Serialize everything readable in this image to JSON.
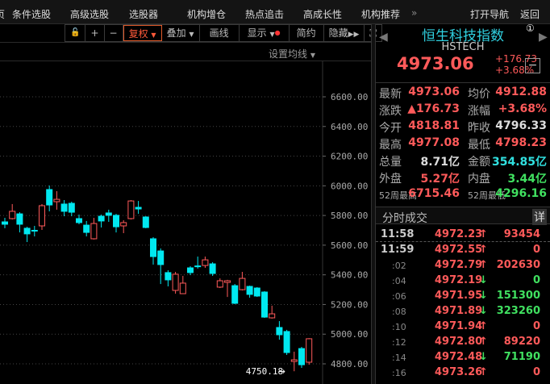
{
  "menu": {
    "items": [
      "页",
      "条件选股",
      "高级选股",
      "选股器",
      "机构增仓",
      "热点追击",
      "高成长性",
      "机构推荐"
    ],
    "more": "»",
    "nav": "打开导航",
    "back": "返回"
  },
  "toolbar": {
    "lock": "🔓",
    "plus": "+",
    "minus": "−",
    "fuquan": "复权",
    "overlay": "叠加",
    "draw": "画线",
    "display": "显示",
    "simple": "简约",
    "hide": "隐藏",
    "expand": "⛶"
  },
  "ma_setting": "设置均线",
  "quote": {
    "name": "恒生科技指数",
    "code": "HSTECH",
    "price": "4973.06",
    "change": "+176.73",
    "pct": "+3.68%",
    "page_badge": "①",
    "collapse": "−"
  },
  "stats": [
    {
      "l1": "最新",
      "v1": "4973.06",
      "c1": "red",
      "l2": "均价",
      "v2": "4912.88",
      "c2": "red"
    },
    {
      "l1": "涨跌",
      "v1": "▲176.73",
      "c1": "red",
      "l2": "涨幅",
      "v2": "+3.68%",
      "c2": "red"
    },
    {
      "l1": "今开",
      "v1": "4818.81",
      "c1": "red",
      "l2": "昨收",
      "v2": "4796.33",
      "c2": "white"
    },
    {
      "l1": "最高",
      "v1": "4977.08",
      "c1": "red",
      "l2": "最低",
      "v2": "4798.23",
      "c2": "red"
    },
    {
      "l1": "总量",
      "v1": "8.71亿",
      "c1": "white",
      "l2": "金额",
      "v2": "354.85亿",
      "c2": "cyan"
    },
    {
      "l1": "外盘",
      "v1": "5.27亿",
      "c1": "red",
      "l2": "内盘",
      "v2": "3.44亿",
      "c2": "green"
    },
    {
      "l1": "52周最高",
      "v1": "6715.46",
      "c1": "red",
      "l2": "52周最低",
      "v2": "4296.16",
      "c2": "green"
    }
  ],
  "ticks_header": {
    "title": "分时成交",
    "detail": "详"
  },
  "ticks": [
    {
      "t": "11:58",
      "p": "4972.23",
      "d": "up",
      "vol": "93454"
    },
    {
      "t": "11:59",
      "p": "4972.55",
      "d": "up",
      "vol": "0"
    },
    {
      "t": ":02",
      "p": "4972.79",
      "d": "up",
      "vol": "202630"
    },
    {
      "t": ":04",
      "p": "4972.19",
      "d": "down",
      "vol": "0"
    },
    {
      "t": ":06",
      "p": "4971.95",
      "d": "down",
      "vol": "151300"
    },
    {
      "t": ":08",
      "p": "4971.89",
      "d": "down",
      "vol": "323260"
    },
    {
      "t": ":10",
      "p": "4971.94",
      "d": "up",
      "vol": "0"
    },
    {
      "t": ":12",
      "p": "4972.80",
      "d": "up",
      "vol": "89220"
    },
    {
      "t": ":14",
      "p": "4972.48",
      "d": "down",
      "vol": "71190"
    },
    {
      "t": ":16",
      "p": "4973.26",
      "d": "up",
      "vol": "0"
    }
  ],
  "colors": {
    "up": "#ff5a5a",
    "down": "#00e8f0",
    "grid": "#444444"
  },
  "chart_data": {
    "type": "candlestick",
    "y_ticks": [
      "6600.00",
      "6400.00",
      "6200.00",
      "6000.00",
      "5800.00",
      "5600.00",
      "5400.00",
      "5200.00",
      "5000.00",
      "4800.00"
    ],
    "ylim": [
      4740,
      6600
    ],
    "low_marker": "4750.18",
    "ohlc": [
      [
        5757,
        5784,
        5714,
        5741
      ],
      [
        5779,
        5877,
        5773,
        5828
      ],
      [
        5811,
        5822,
        5686,
        5741
      ],
      [
        5714,
        5724,
        5621,
        5676
      ],
      [
        5700,
        5730,
        5659,
        5697
      ],
      [
        5730,
        5877,
        5703,
        5866
      ],
      [
        5975,
        6002,
        5828,
        5871
      ],
      [
        5893,
        5964,
        5839,
        5909
      ],
      [
        5877,
        5904,
        5795,
        5828
      ],
      [
        5882,
        5893,
        5795,
        5822
      ],
      [
        5779,
        5806,
        5741,
        5752
      ],
      [
        5735,
        5763,
        5659,
        5686
      ],
      [
        5643,
        5784,
        5638,
        5746
      ],
      [
        5795,
        5806,
        5719,
        5763
      ],
      [
        5817,
        5839,
        5757,
        5801
      ],
      [
        5801,
        5811,
        5686,
        5724
      ],
      [
        5730,
        5768,
        5681,
        5752
      ],
      [
        5779,
        5904,
        5773,
        5898
      ],
      [
        5855,
        5898,
        5811,
        5844
      ],
      [
        5790,
        5795,
        5714,
        5719
      ],
      [
        5643,
        5654,
        5469,
        5523
      ],
      [
        5561,
        5578,
        5338,
        5469
      ],
      [
        5415,
        5431,
        5322,
        5366
      ],
      [
        5295,
        5420,
        5273,
        5404
      ],
      [
        5273,
        5393,
        5273,
        5344
      ],
      [
        5447,
        5458,
        5398,
        5415
      ],
      [
        5460,
        5523,
        5442,
        5455
      ],
      [
        5463,
        5523,
        5447,
        5501
      ],
      [
        5474,
        5485,
        5393,
        5409
      ],
      [
        5317,
        5376,
        5311,
        5360
      ],
      [
        5349,
        5366,
        5251,
        5360
      ],
      [
        5327,
        5338,
        5203,
        5208
      ],
      [
        5300,
        5420,
        5295,
        5376
      ],
      [
        5322,
        5327,
        5246,
        5268
      ],
      [
        5311,
        5317,
        5251,
        5257
      ],
      [
        5284,
        5290,
        5110,
        5115
      ],
      [
        5110,
        5192,
        5105,
        5137
      ],
      [
        5045,
        5088,
        4963,
        4996
      ],
      [
        5018,
        5029,
        4860,
        4876
      ],
      [
        4816,
        4882,
        4750,
        4827
      ],
      [
        4903,
        4914,
        4773,
        4794
      ],
      [
        4811,
        4973,
        4794,
        4969
      ]
    ]
  }
}
